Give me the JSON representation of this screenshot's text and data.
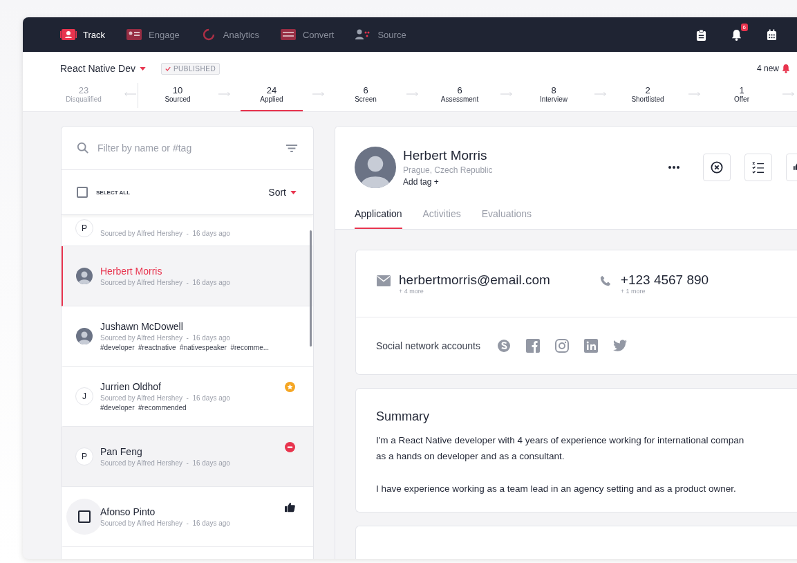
{
  "nav": {
    "items": [
      {
        "label": "Track",
        "kind": "card",
        "selected": true
      },
      {
        "label": "Engage",
        "kind": "contact",
        "selected": false
      },
      {
        "label": "Analytics",
        "kind": "ring",
        "selected": false
      },
      {
        "label": "Convert",
        "kind": "form",
        "selected": false
      },
      {
        "label": "Source",
        "kind": "people",
        "selected": false
      }
    ],
    "notification_count": "6"
  },
  "job": {
    "title": "React Native Dev",
    "status": "PUBLISHED",
    "new_count": "4 new"
  },
  "stages": [
    {
      "count": "23",
      "label": "Disqualified",
      "kind": "excluded",
      "selected": false
    },
    {
      "count": "10",
      "label": "Sourced",
      "kind": "stage",
      "selected": false
    },
    {
      "count": "24",
      "label": "Applied",
      "kind": "stage",
      "selected": true
    },
    {
      "count": "6",
      "label": "Screen",
      "kind": "stage",
      "selected": false
    },
    {
      "count": "6",
      "label": "Assessment",
      "kind": "stage",
      "selected": false
    },
    {
      "count": "8",
      "label": "Interview",
      "kind": "stage",
      "selected": false
    },
    {
      "count": "2",
      "label": "Shortlisted",
      "kind": "stage",
      "selected": false
    },
    {
      "count": "1",
      "label": "Offer",
      "kind": "stage",
      "selected": false
    }
  ],
  "search": {
    "placeholder": "Filter by name or #tag"
  },
  "select_all": {
    "label": "SELECT ALL",
    "checked": false
  },
  "sort": {
    "label": "Sort"
  },
  "candidates": [
    {
      "avatar": {
        "kind": "initial",
        "initial": "P"
      },
      "subtitle": "Sourced by Alfred Hershey  -  16 days ago",
      "selected": false,
      "highlighted": false
    },
    {
      "avatar": {
        "kind": "photo"
      },
      "name": "Herbert Morris",
      "subtitle": "Sourced by Alfred Hershey  -  16 days ago",
      "selected": true,
      "highlighted": false
    },
    {
      "avatar": {
        "kind": "photo"
      },
      "name": "Jushawn McDowell",
      "subtitle": "Sourced by Alfred Hershey  -  16 days ago",
      "tags": "#developer  #reactnative  #nativespeaker  #recomme...",
      "selected": false,
      "highlighted": false
    },
    {
      "avatar": {
        "kind": "initial",
        "initial": "J"
      },
      "name": "Jurrien Oldhof",
      "subtitle": "Sourced by Alfred Hershey  -  16 days ago",
      "tags": "#developer  #recommended",
      "badge": {
        "kind": "star"
      },
      "selected": false,
      "highlighted": false
    },
    {
      "avatar": {
        "kind": "initial",
        "initial": "P"
      },
      "name": "Pan Feng",
      "subtitle": "Sourced by Alfred Hershey  -  16 days ago",
      "badge": {
        "kind": "rejected"
      },
      "selected": false,
      "highlighted": true
    },
    {
      "avatar": {
        "kind": "checkbox",
        "checked": false
      },
      "name": "Afonso Pinto",
      "subtitle": "Sourced by Alfred Hershey  -  16 days ago",
      "badge": {
        "kind": "liked"
      },
      "selected": false,
      "highlighted": false
    }
  ],
  "profile": {
    "name": "Herbert Morris",
    "location": "Prague, Czech Republic",
    "add_tag": "Add tag +"
  },
  "tabs": [
    {
      "label": "Application",
      "selected": true
    },
    {
      "label": "Activities",
      "selected": false
    },
    {
      "label": "Evaluations",
      "selected": false
    }
  ],
  "contact": {
    "email": "herbertmorris@email.com",
    "email_more": "+ 4 more",
    "phone": "+123 4567 890",
    "phone_more": "+ 1 more",
    "social_label": "Social network accounts",
    "social": [
      {
        "kind": "skype"
      },
      {
        "kind": "facebook"
      },
      {
        "kind": "instagram"
      },
      {
        "kind": "linkedin"
      },
      {
        "kind": "twitter"
      }
    ]
  },
  "summary": {
    "title": "Summary",
    "paragraphs": [
      "I'm a React Native developer with 4 years of experience working for international compan",
      "as a hands on developer and as a consultant.",
      "I have experience working as a team lead in an agency setting and as a product owner."
    ]
  }
}
